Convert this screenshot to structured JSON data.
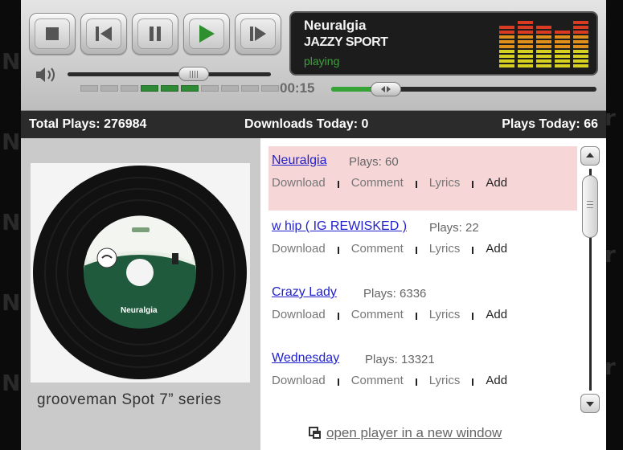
{
  "player": {
    "now_playing": {
      "title": "Neuralgia",
      "artist": "JAZZY SPORT",
      "status": "playing"
    },
    "elapsed_time": "00:15",
    "progress_fraction": 0.15,
    "volume_fraction": 0.62,
    "volume_segments_total": 10,
    "volume_segments_active": [
      4,
      5,
      6
    ],
    "controls": {
      "stop_icon": "stop-icon",
      "prev_icon": "skip-back-icon",
      "pause_icon": "pause-icon",
      "play_icon": "play-icon",
      "next_icon": "skip-forward-icon",
      "volume_icon": "speaker-icon"
    },
    "equalizer": {
      "levels": [
        9,
        10,
        9,
        8,
        10
      ],
      "colors": {
        "low": "#d6d020",
        "mid": "#e0901a",
        "high": "#d83a22"
      }
    }
  },
  "stats": {
    "total_plays": "Total Plays: 276984",
    "downloads_today": "Downloads Today: 0",
    "plays_today": "Plays Today:  66"
  },
  "album": {
    "caption": "grooveman Spot 7” series",
    "label_text": "Neuralgia"
  },
  "tracks": [
    {
      "title": "Neuralgia",
      "plays": "Plays: 60",
      "selected": true
    },
    {
      "title": "w hip ( IG REWISKED )",
      "plays": "Plays: 22",
      "selected": false
    },
    {
      "title": "Crazy Lady",
      "plays": "Plays: 6336",
      "selected": false
    },
    {
      "title": "Wednesday",
      "plays": "Plays: 13321",
      "selected": false
    }
  ],
  "track_actions": {
    "download": "Download",
    "comment": "Comment",
    "lyrics": "Lyrics",
    "add": "Add"
  },
  "open_new_window": "open player in a new window",
  "colors": {
    "accent_green": "#35a335",
    "selected_row": "#f7d6d7",
    "link_blue": "#1f1fcc",
    "stats_bar": "#2b2b2b"
  }
}
